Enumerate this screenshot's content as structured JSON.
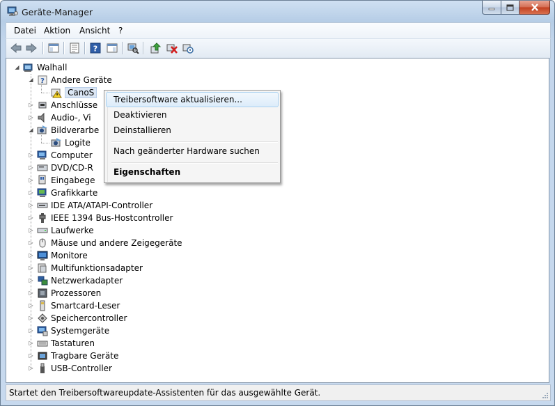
{
  "window": {
    "title": "Geräte-Manager"
  },
  "menu": [
    "Datei",
    "Aktion",
    "Ansicht",
    "?"
  ],
  "toolbar": {
    "icons": [
      "back-icon",
      "forward-icon",
      "show-hide-console-tree-icon",
      "properties-icon",
      "help-icon",
      "action-pane-icon",
      "scan-hardware-icon",
      "update-driver-icon",
      "uninstall-icon",
      "disable-icon"
    ]
  },
  "tree": {
    "root": "Walhall",
    "categories": [
      {
        "label": "Andere Geräte",
        "expanded": true,
        "icon": "unknown-device-icon"
      },
      {
        "label": "CanoS",
        "child": true,
        "icon": "warning-device-icon"
      },
      {
        "label": "Anschlüsse",
        "icon": "port-icon"
      },
      {
        "label": "Audio-, Vi",
        "icon": "audio-icon"
      },
      {
        "label": "Bildverarbe",
        "expanded": true,
        "icon": "camera-icon"
      },
      {
        "label": "Logite",
        "child": true,
        "icon": "webcam-icon"
      },
      {
        "label": "Computer",
        "icon": "computer-icon"
      },
      {
        "label": "DVD/CD-R",
        "icon": "dvd-drive-icon"
      },
      {
        "label": "Eingabege",
        "icon": "input-device-icon"
      },
      {
        "label": "Grafikkarte",
        "icon": "display-adapter-icon"
      },
      {
        "label": "IDE ATA/ATAPI-Controller",
        "icon": "ide-controller-icon"
      },
      {
        "label": "IEEE 1394 Bus-Hostcontroller",
        "icon": "firewire-icon"
      },
      {
        "label": "Laufwerke",
        "icon": "disk-drive-icon"
      },
      {
        "label": "Mäuse und andere Zeigegeräte",
        "icon": "mouse-icon"
      },
      {
        "label": "Monitore",
        "icon": "monitor-icon"
      },
      {
        "label": "Multifunktionsadapter",
        "icon": "multifunction-icon"
      },
      {
        "label": "Netzwerkadapter",
        "icon": "network-adapter-icon"
      },
      {
        "label": "Prozessoren",
        "icon": "processor-icon"
      },
      {
        "label": "Smartcard-Leser",
        "icon": "smartcard-icon"
      },
      {
        "label": "Speichercontroller",
        "icon": "storage-controller-icon"
      },
      {
        "label": "Systemgeräte",
        "icon": "system-device-icon"
      },
      {
        "label": "Tastaturen",
        "icon": "keyboard-icon"
      },
      {
        "label": "Tragbare Geräte",
        "icon": "portable-device-icon"
      },
      {
        "label": "USB-Controller",
        "icon": "usb-icon"
      }
    ]
  },
  "context_menu": {
    "items": [
      {
        "label": "Treibersoftware aktualisieren...",
        "highlighted": true
      },
      {
        "label": "Deaktivieren"
      },
      {
        "label": "Deinstallieren"
      },
      {
        "label": "Nach geänderter Hardware suchen"
      },
      {
        "label": "Eigenschaften",
        "bold": true
      }
    ]
  },
  "status": {
    "text": "Startet den Treibersoftwareupdate-Assistenten für das ausgewählte Gerät."
  },
  "colors": {
    "window_frame": "#c3d6ec",
    "menu_highlight": "#dcecfa",
    "tree_bg": "#ffffff"
  }
}
